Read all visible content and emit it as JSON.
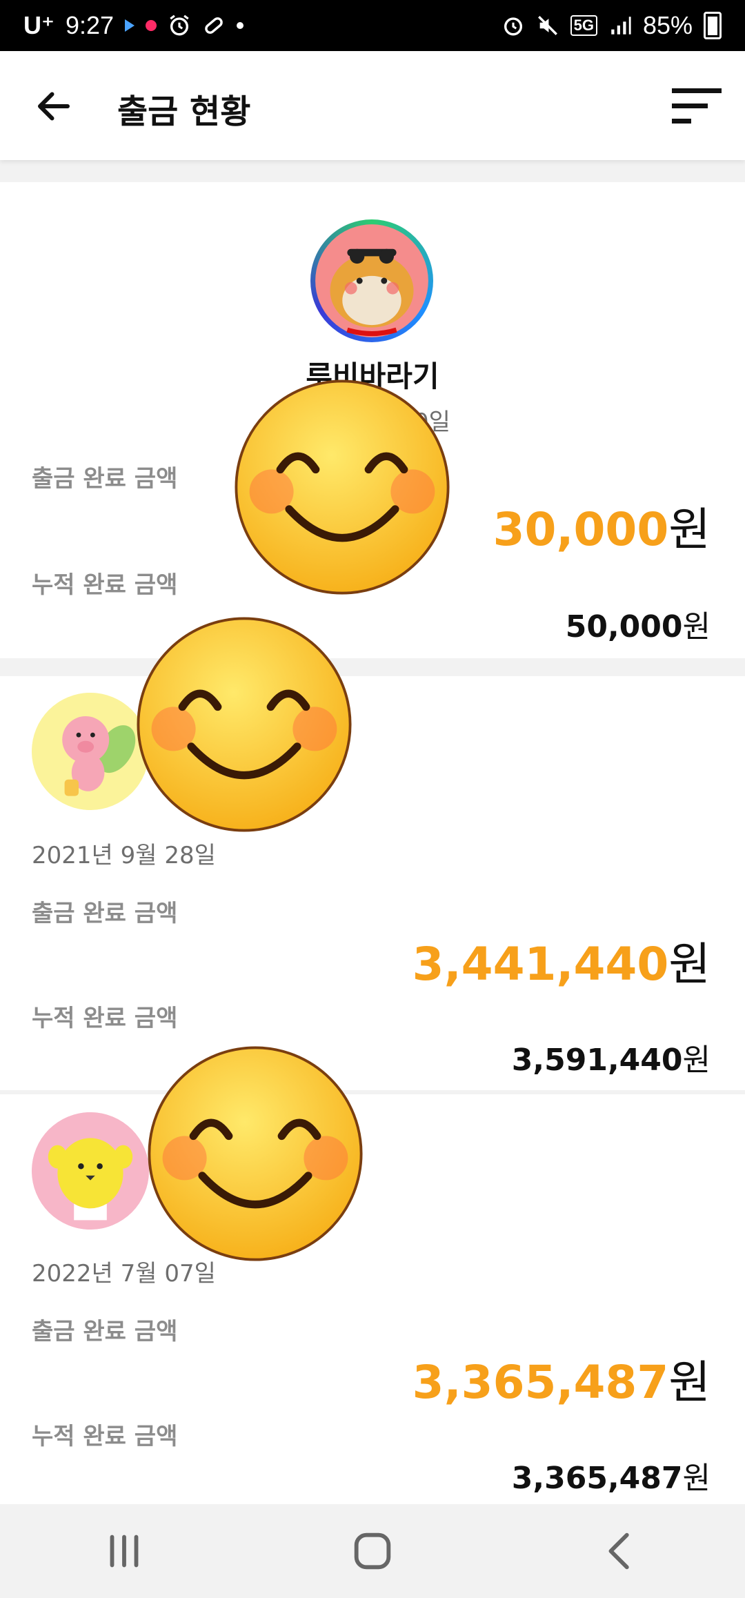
{
  "status_bar": {
    "carrier": "U⁺",
    "time": "9:27",
    "network": "5G",
    "battery": "85%"
  },
  "app_bar": {
    "title": "출금 현황",
    "back_icon": "arrow-left-icon",
    "menu_icon": "sort-icon"
  },
  "cards": [
    {
      "name": "루비바라기",
      "date_fragment": "0일",
      "labels": {
        "withdraw": "출금 완료 금액",
        "cumulative": "누적 완료 금액"
      },
      "withdraw_amount": "30,000",
      "cumulative_amount": "50,000",
      "currency": "원"
    },
    {
      "date": "2021년 9월 28일",
      "labels": {
        "withdraw": "출금 완료 금액",
        "cumulative": "누적 완료 금액"
      },
      "withdraw_amount": "3,441,440",
      "cumulative_amount": "3,591,440",
      "currency": "원"
    },
    {
      "date": "2022년 7월 07일",
      "labels": {
        "withdraw": "출금 완료 금액",
        "cumulative": "누적 완료 금액"
      },
      "withdraw_amount": "3,365,487",
      "cumulative_amount": "3,365,487",
      "currency": "원"
    }
  ],
  "colors": {
    "accent_amount": "#f7a01a",
    "label_gray": "#8c8c8c",
    "date_gray": "#6e6e6e"
  },
  "nav_bar": {
    "recents_icon": "recents-icon",
    "home_icon": "home-icon",
    "back_icon": "back-chevron-icon"
  }
}
